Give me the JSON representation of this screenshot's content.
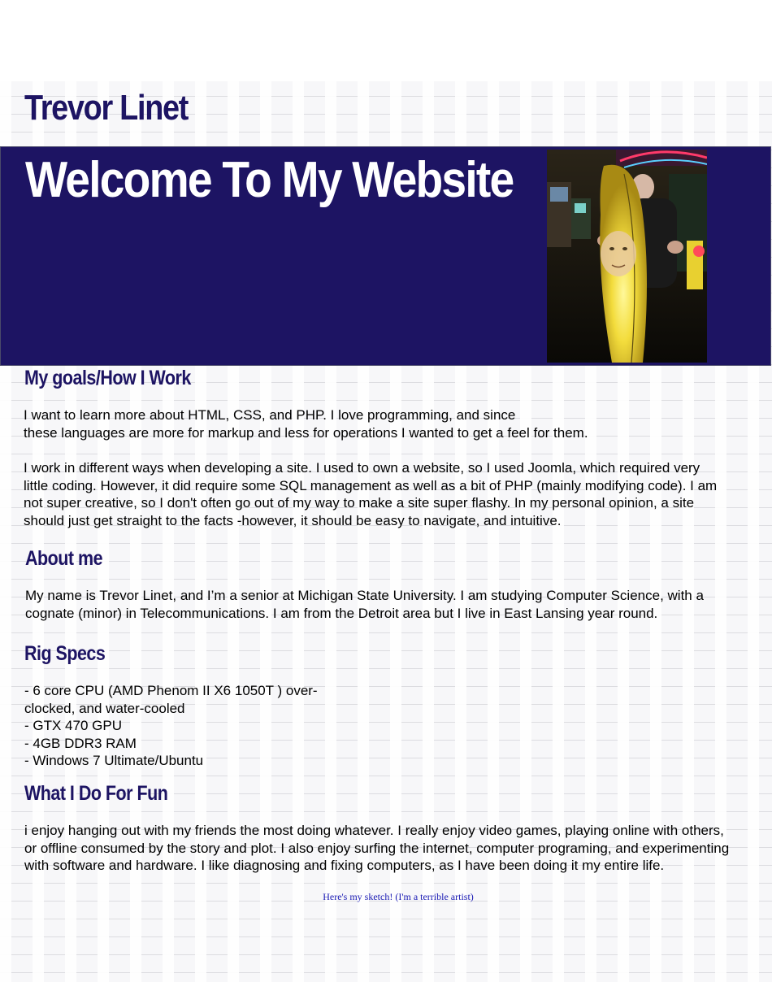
{
  "site": {
    "title": "Trevor Linet",
    "banner_title": "Welcome To My Website",
    "photo_alt": "Photo of Trevor holding a banana costume"
  },
  "goals": {
    "heading": "My goals/How I Work",
    "p1_line1": "I want to learn more about HTML, CSS, and PHP. I love programming, and since",
    "p1_line2": "these languages are more for markup and less for operations I wanted to get a feel for them.",
    "p2_line1": "I work in different ways when developing a site. I used to own a website, so I used Joomla, which required very",
    "p2_line2": "little coding. However, it did require some SQL management as well as a bit of PHP (mainly modifying code). I am",
    "p2_line3": "not super creative, so I don't often go out of my way to make a site super flashy. In my personal opinion, a site",
    "p2_line4": "should just get straight to the facts -however, it should be easy to navigate, and intuitive."
  },
  "about": {
    "heading": "About me",
    "line1": "My name is Trevor Linet, and I’m a senior at Michigan State University. I am studying Computer Science, with a",
    "line2": "cognate (minor) in Telecommunications. I am from the Detroit area but I live in East Lansing year round."
  },
  "rig": {
    "heading": "Rig Specs",
    "items": [
      "- 6 core CPU (AMD Phenom II X6 1050T ) over-",
      "clocked, and water-cooled",
      "- GTX 470 GPU",
      "- 4GB DDR3 RAM",
      "- Windows 7 Ultimate/Ubuntu"
    ]
  },
  "fun": {
    "heading": "What I Do For Fun",
    "line1": "i enjoy hanging out with my friends the most doing whatever. I really enjoy video games, playing online with others,",
    "line2": "or offline consumed by the story and plot. I also enjoy surfing the internet, computer programing, and experimenting",
    "line3": "with software and hardware. I like diagnosing and fixing computers, as I have been doing it my entire life."
  },
  "sketch_link": "Here's my sketch! (I'm a terrible artist)",
  "colors": {
    "heading": "#1d1463",
    "banner_bg": "#1d1463",
    "link": "#1a1ab4"
  }
}
